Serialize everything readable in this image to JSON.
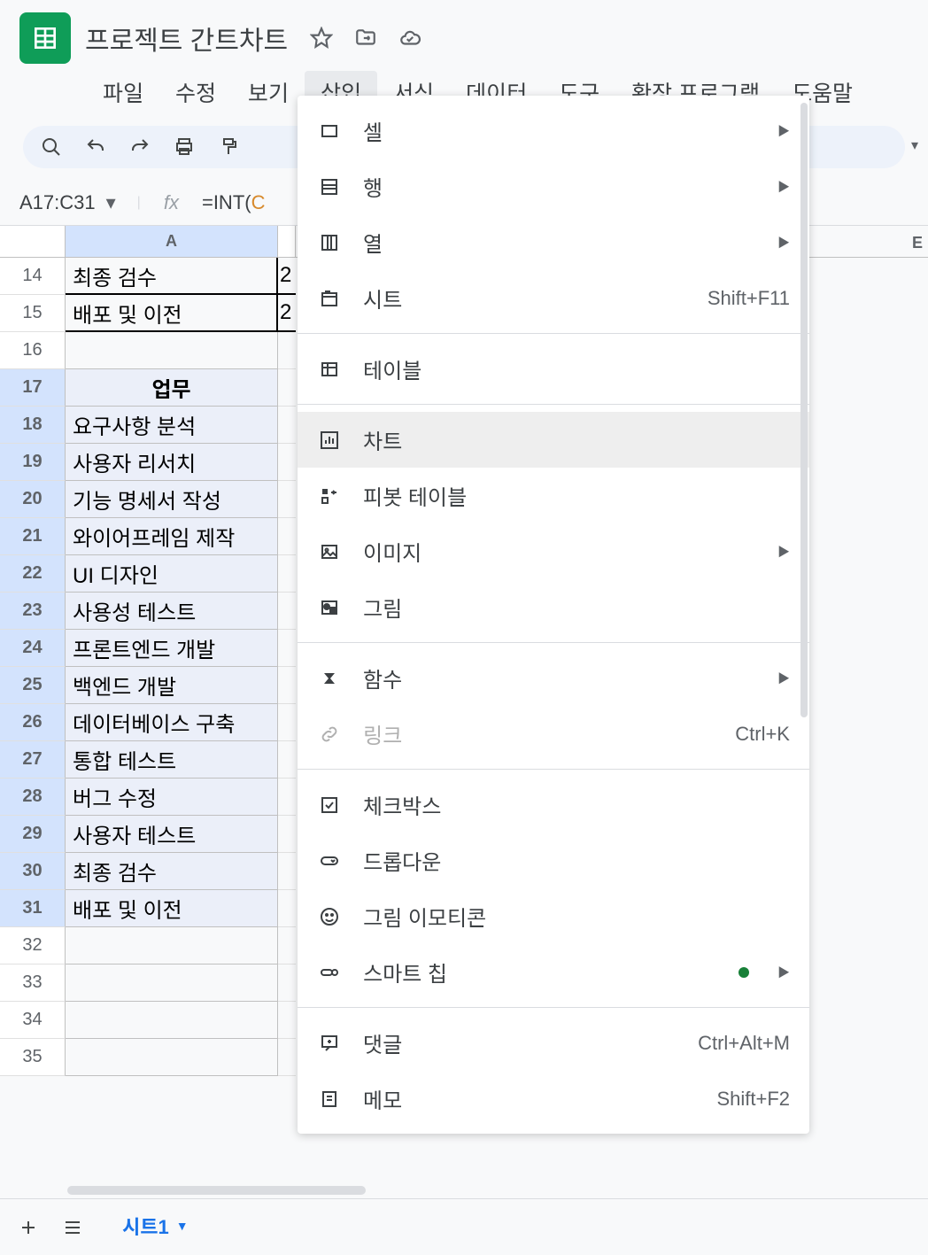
{
  "doc": {
    "title": "프로젝트 간트차트"
  },
  "menubar": [
    "파일",
    "수정",
    "보기",
    "삽입",
    "서식",
    "데이터",
    "도구",
    "확장 프로그램",
    "도움말"
  ],
  "activeMenu": "삽입",
  "nameBox": "A17:C31",
  "formula": {
    "prefix": "=",
    "fn": "INT",
    "open": "(",
    "ref": "C"
  },
  "colHeaders": [
    "A"
  ],
  "partialColE": "E",
  "rows": [
    {
      "num": "14",
      "a": "최종 검수",
      "next": "2",
      "sel": false,
      "bordered": true
    },
    {
      "num": "15",
      "a": "배포 및 이전",
      "next": "2",
      "sel": false,
      "bordered": true
    },
    {
      "num": "16",
      "a": "",
      "next": "",
      "sel": false,
      "bordered": false
    },
    {
      "num": "17",
      "a": "업무",
      "next": "",
      "sel": true,
      "bordered": false,
      "header": true
    },
    {
      "num": "18",
      "a": "요구사항 분석",
      "next": "",
      "sel": true,
      "bordered": false
    },
    {
      "num": "19",
      "a": "사용자 리서치",
      "next": "",
      "sel": true,
      "bordered": false
    },
    {
      "num": "20",
      "a": "기능 명세서 작성",
      "next": "",
      "sel": true,
      "bordered": false
    },
    {
      "num": "21",
      "a": "와이어프레임 제작",
      "next": "",
      "sel": true,
      "bordered": false
    },
    {
      "num": "22",
      "a": "UI 디자인",
      "next": "",
      "sel": true,
      "bordered": false
    },
    {
      "num": "23",
      "a": "사용성 테스트",
      "next": "",
      "sel": true,
      "bordered": false
    },
    {
      "num": "24",
      "a": "프론트엔드 개발",
      "next": "",
      "sel": true,
      "bordered": false
    },
    {
      "num": "25",
      "a": "백엔드 개발",
      "next": "",
      "sel": true,
      "bordered": false
    },
    {
      "num": "26",
      "a": "데이터베이스 구축",
      "next": "",
      "sel": true,
      "bordered": false
    },
    {
      "num": "27",
      "a": "통합 테스트",
      "next": "",
      "sel": true,
      "bordered": false
    },
    {
      "num": "28",
      "a": "버그 수정",
      "next": "",
      "sel": true,
      "bordered": false
    },
    {
      "num": "29",
      "a": "사용자 테스트",
      "next": "",
      "sel": true,
      "bordered": false
    },
    {
      "num": "30",
      "a": "최종 검수",
      "next": "",
      "sel": true,
      "bordered": false
    },
    {
      "num": "31",
      "a": "배포 및 이전",
      "next": "",
      "sel": true,
      "bordered": false
    },
    {
      "num": "32",
      "a": "",
      "next": "",
      "sel": false,
      "bordered": false
    },
    {
      "num": "33",
      "a": "",
      "next": "",
      "sel": false,
      "bordered": false
    },
    {
      "num": "34",
      "a": "",
      "next": "",
      "sel": false,
      "bordered": false
    },
    {
      "num": "35",
      "a": "",
      "next": "",
      "sel": false,
      "bordered": false
    }
  ],
  "insertMenu": [
    {
      "label": "셀",
      "icon": "cells",
      "arrow": true
    },
    {
      "label": "행",
      "icon": "rows",
      "arrow": true
    },
    {
      "label": "열",
      "icon": "cols",
      "arrow": true
    },
    {
      "label": "시트",
      "icon": "sheet",
      "shortcut": "Shift+F11"
    },
    {
      "sep": true
    },
    {
      "label": "테이블",
      "icon": "table"
    },
    {
      "sep": true
    },
    {
      "label": "차트",
      "icon": "chart",
      "hover": true
    },
    {
      "label": "피봇 테이블",
      "icon": "pivot"
    },
    {
      "label": "이미지",
      "icon": "image",
      "arrow": true
    },
    {
      "label": "그림",
      "icon": "drawing"
    },
    {
      "sep": true
    },
    {
      "label": "함수",
      "icon": "function",
      "arrow": true
    },
    {
      "label": "링크",
      "icon": "link",
      "shortcut": "Ctrl+K",
      "disabled": true
    },
    {
      "sep": true
    },
    {
      "label": "체크박스",
      "icon": "checkbox"
    },
    {
      "label": "드롭다운",
      "icon": "dropdown"
    },
    {
      "label": "그림 이모티콘",
      "icon": "emoji"
    },
    {
      "label": "스마트 칩",
      "icon": "smartchip",
      "arrow": true,
      "dot": true
    },
    {
      "sep": true
    },
    {
      "label": "댓글",
      "icon": "comment",
      "shortcut": "Ctrl+Alt+M"
    },
    {
      "label": "메모",
      "icon": "note",
      "shortcut": "Shift+F2"
    }
  ],
  "sheetTab": "시트1"
}
